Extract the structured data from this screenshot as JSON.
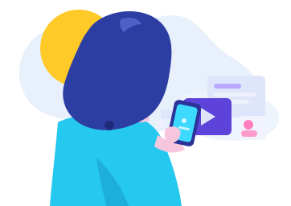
{
  "illustration": {
    "subject": "woman-using-phone-with-floating-app-cards",
    "palette": {
      "background": "#ffffff",
      "blob_blue": "#e7f0fb",
      "sun": "#ffc928",
      "hair": "#2d3ea2",
      "hair_highlight": "#4e61c8",
      "skin": "#f6c6dc",
      "shirt": "#25c9ef",
      "shirt_dark": "#1797c7",
      "phone": "#2b3398",
      "phone_screen": "#3dd9ff",
      "card_light": "#dfe6fb",
      "card_lilac": "#b9a7ff",
      "card_purple": "#5d43d9",
      "play_button": "#5d43d9",
      "pink": "#ff7fbf"
    }
  }
}
